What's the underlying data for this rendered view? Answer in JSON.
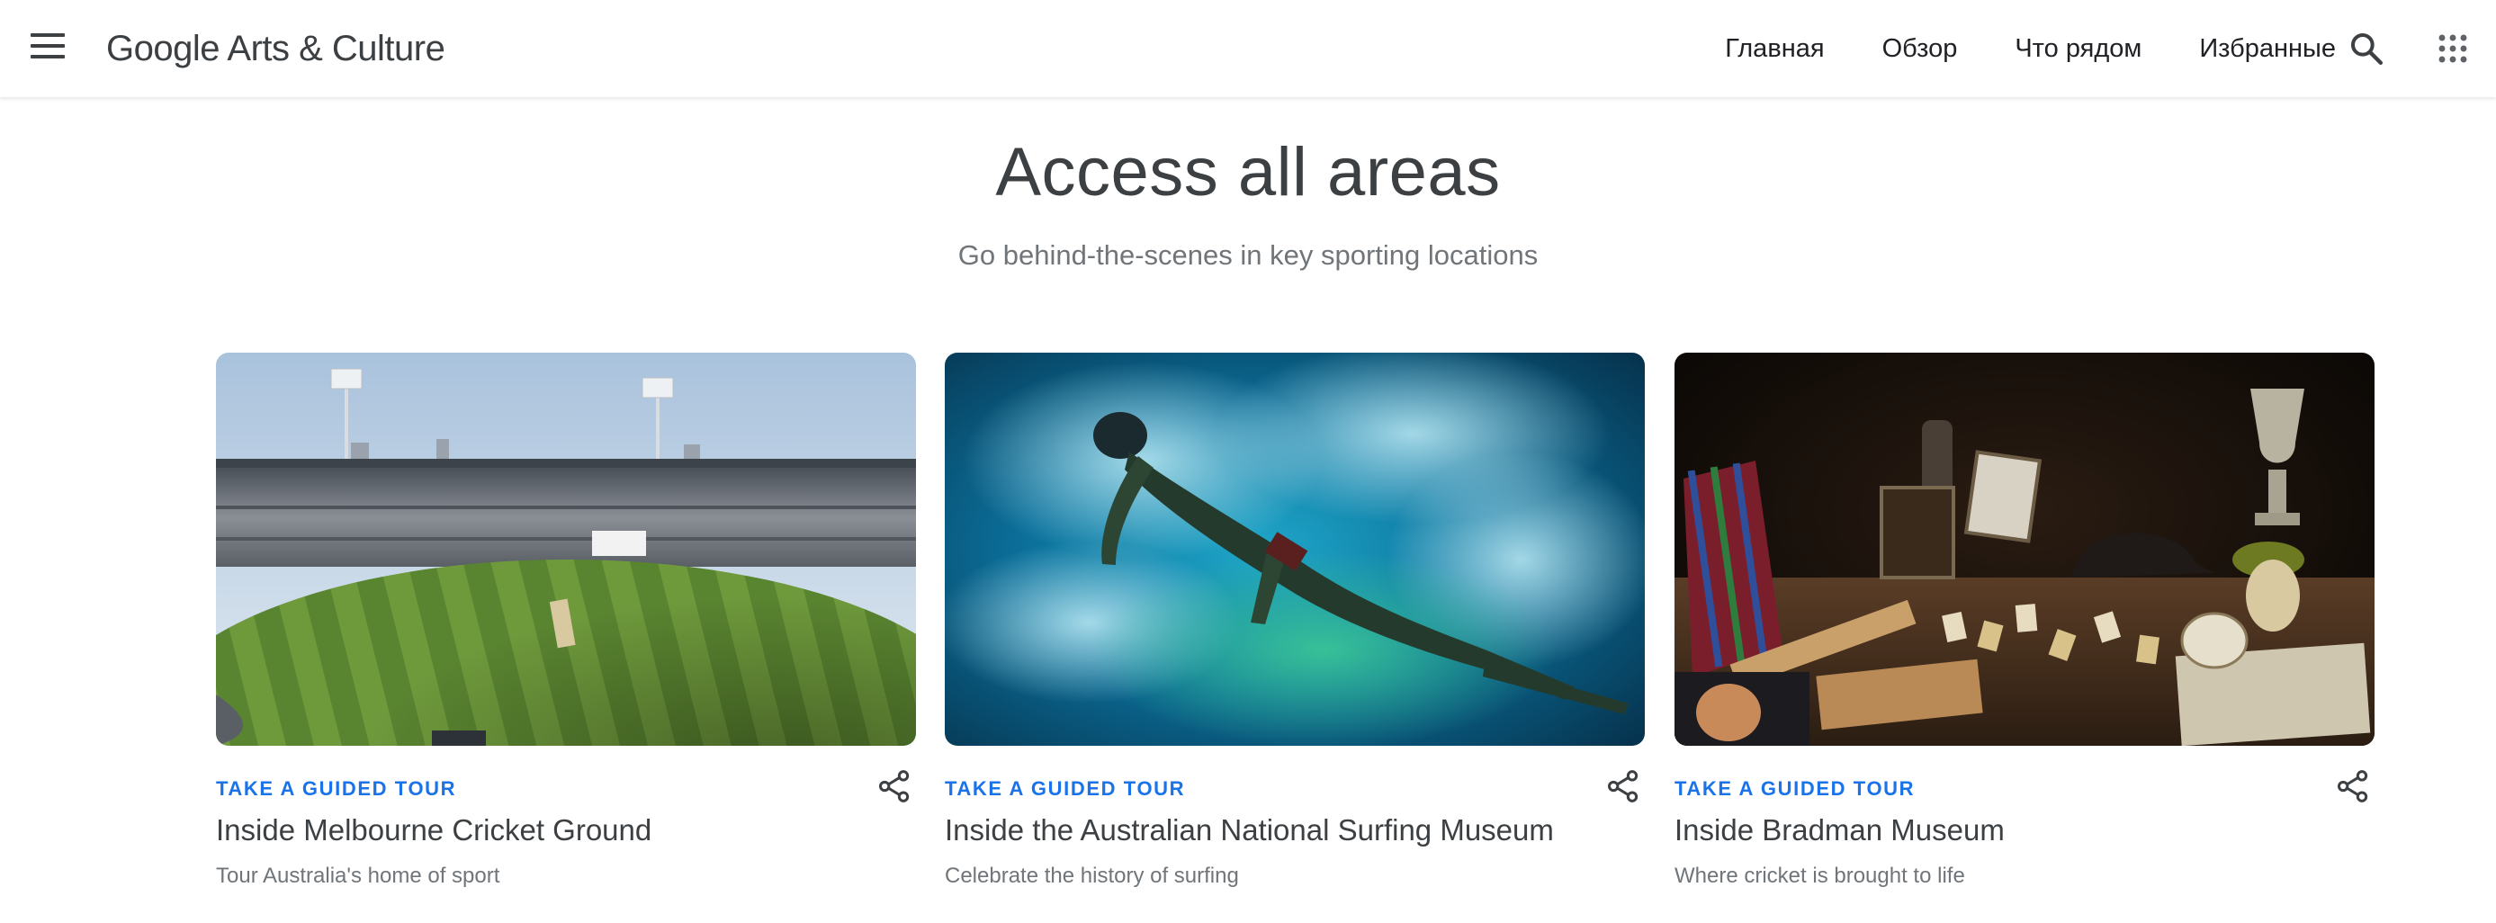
{
  "header": {
    "logo_text": "Google Arts & Culture",
    "nav": [
      {
        "label": "Главная"
      },
      {
        "label": "Обзор"
      },
      {
        "label": "Что рядом"
      },
      {
        "label": "Избранные"
      }
    ],
    "icons": {
      "menu": "menu-icon",
      "search": "search-icon",
      "apps": "apps-grid-icon"
    }
  },
  "section": {
    "title": "Access all areas",
    "subtitle": "Go behind-the-scenes in key sporting locations"
  },
  "cards": [
    {
      "eyebrow": "TAKE A GUIDED TOUR",
      "title": "Inside Melbourne Cricket Ground",
      "description": "Tour Australia's home of sport",
      "image": "stadium-photo"
    },
    {
      "eyebrow": "TAKE A GUIDED TOUR",
      "title": "Inside the Australian National Surfing Museum",
      "description": "Celebrate the history of surfing",
      "image": "underwater-surfer-photo"
    },
    {
      "eyebrow": "TAKE A GUIDED TOUR",
      "title": "Inside Bradman Museum",
      "description": "Where cricket is brought to life",
      "image": "cricket-memorabilia-photo"
    }
  ],
  "colors": {
    "accent": "#1a73e8",
    "text_primary": "#202124",
    "text_secondary": "#70757a"
  }
}
